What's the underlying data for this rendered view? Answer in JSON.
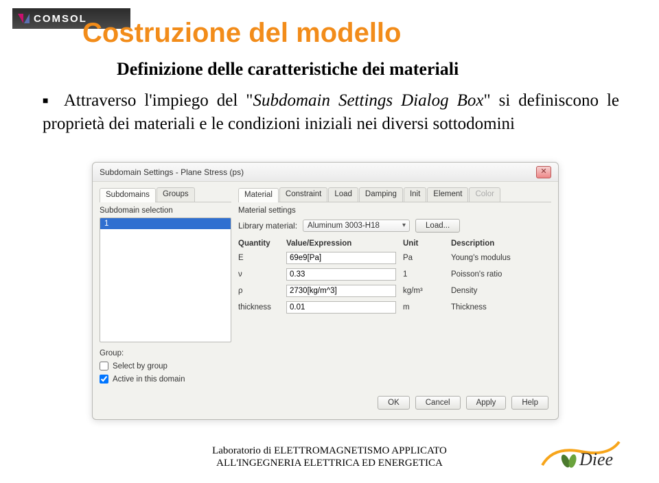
{
  "header": {
    "logo_text": "COMSOL",
    "title": "Costruzione del modello",
    "subtitle": "Definizione delle caratteristiche dei materiali"
  },
  "desc": {
    "pre": "Attraverso l'impiego del \"",
    "em": "Subdomain Settings Dialog Box",
    "post": "\" si definiscono le proprietà dei materiali e le condizioni iniziali nei diversi sottodomini"
  },
  "dialog": {
    "title": "Subdomain Settings - Plane Stress (ps)",
    "close_label": "✕",
    "left_tabs": [
      "Subdomains",
      "Groups"
    ],
    "left_active_tab": 0,
    "selection_label": "Subdomain selection",
    "list_items": [
      "1"
    ],
    "group_label": "Group:",
    "chk_select_by_group": "Select by group",
    "chk_active": "Active in this domain",
    "chk_active_checked": true,
    "right_tabs": [
      "Material",
      "Constraint",
      "Load",
      "Damping",
      "Init",
      "Element",
      "Color"
    ],
    "right_active_tab": 0,
    "right_disabled_tabs": [
      6
    ],
    "material_settings_label": "Material settings",
    "library_label": "Library material:",
    "library_value": "Aluminum 3003-H18",
    "load_button": "Load...",
    "columns": [
      "Quantity",
      "Value/Expression",
      "Unit",
      "Description"
    ],
    "rows": [
      {
        "q": "E",
        "v": "69e9[Pa]",
        "u": "Pa",
        "d": "Young's modulus"
      },
      {
        "q": "ν",
        "v": "0.33",
        "u": "1",
        "d": "Poisson's ratio"
      },
      {
        "q": "ρ",
        "v": "2730[kg/m^3]",
        "u": "kg/m³",
        "d": "Density"
      },
      {
        "q": "thickness",
        "v": "0.01",
        "u": "m",
        "d": "Thickness"
      }
    ],
    "buttons": [
      "OK",
      "Cancel",
      "Apply",
      "Help"
    ]
  },
  "footer": {
    "line1": "Laboratorio di ELETTROMAGNETISMO APPLICATO",
    "line2": "ALL'INGEGNERIA ELETTRICA ED ENERGETICA",
    "logo_text": "Diee"
  }
}
